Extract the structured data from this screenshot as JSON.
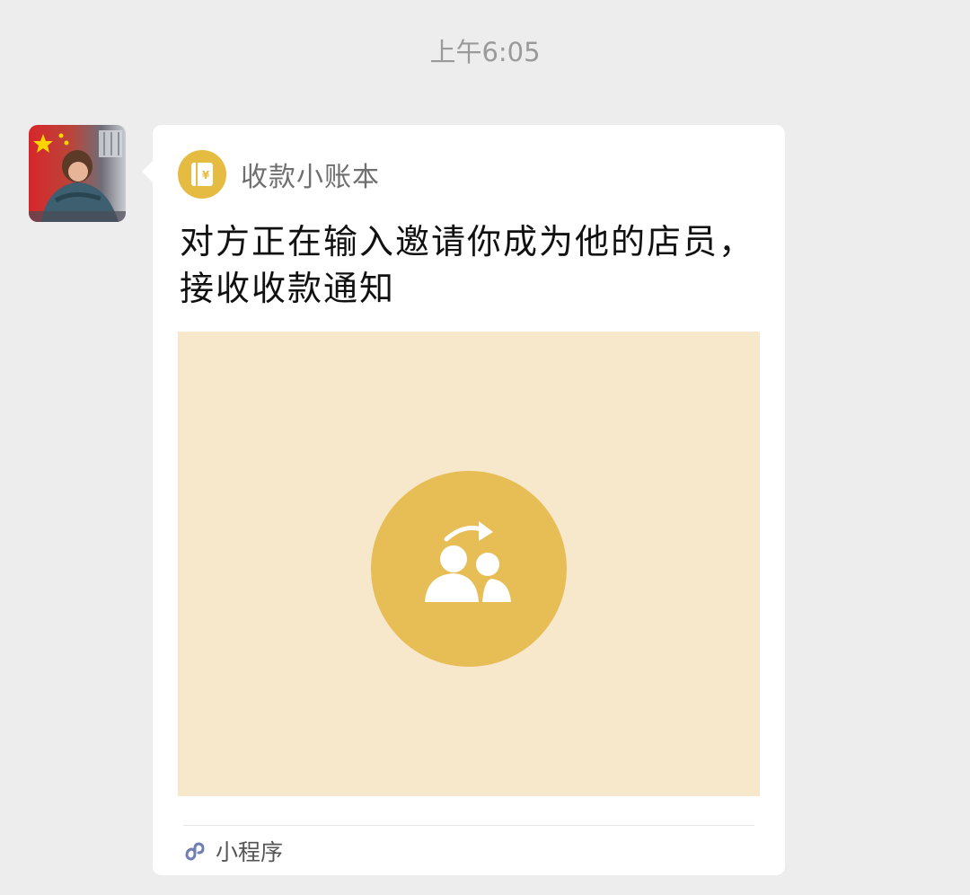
{
  "chat": {
    "timestamp": "上午6:05"
  },
  "message": {
    "sender_avatar": "avatar-icon",
    "app_name": "收款小账本",
    "app_icon": "ledger-yuan-icon",
    "title": "对方正在输入邀请你成为他的店员，接收收款通知",
    "preview_icon": "invite-users-icon",
    "footer_label": "小程序",
    "footer_icon": "mini-program-icon"
  },
  "colors": {
    "background": "#ededed",
    "card": "#ffffff",
    "accent_gold": "#e6bb42",
    "preview_bg": "#f7e8cc"
  }
}
